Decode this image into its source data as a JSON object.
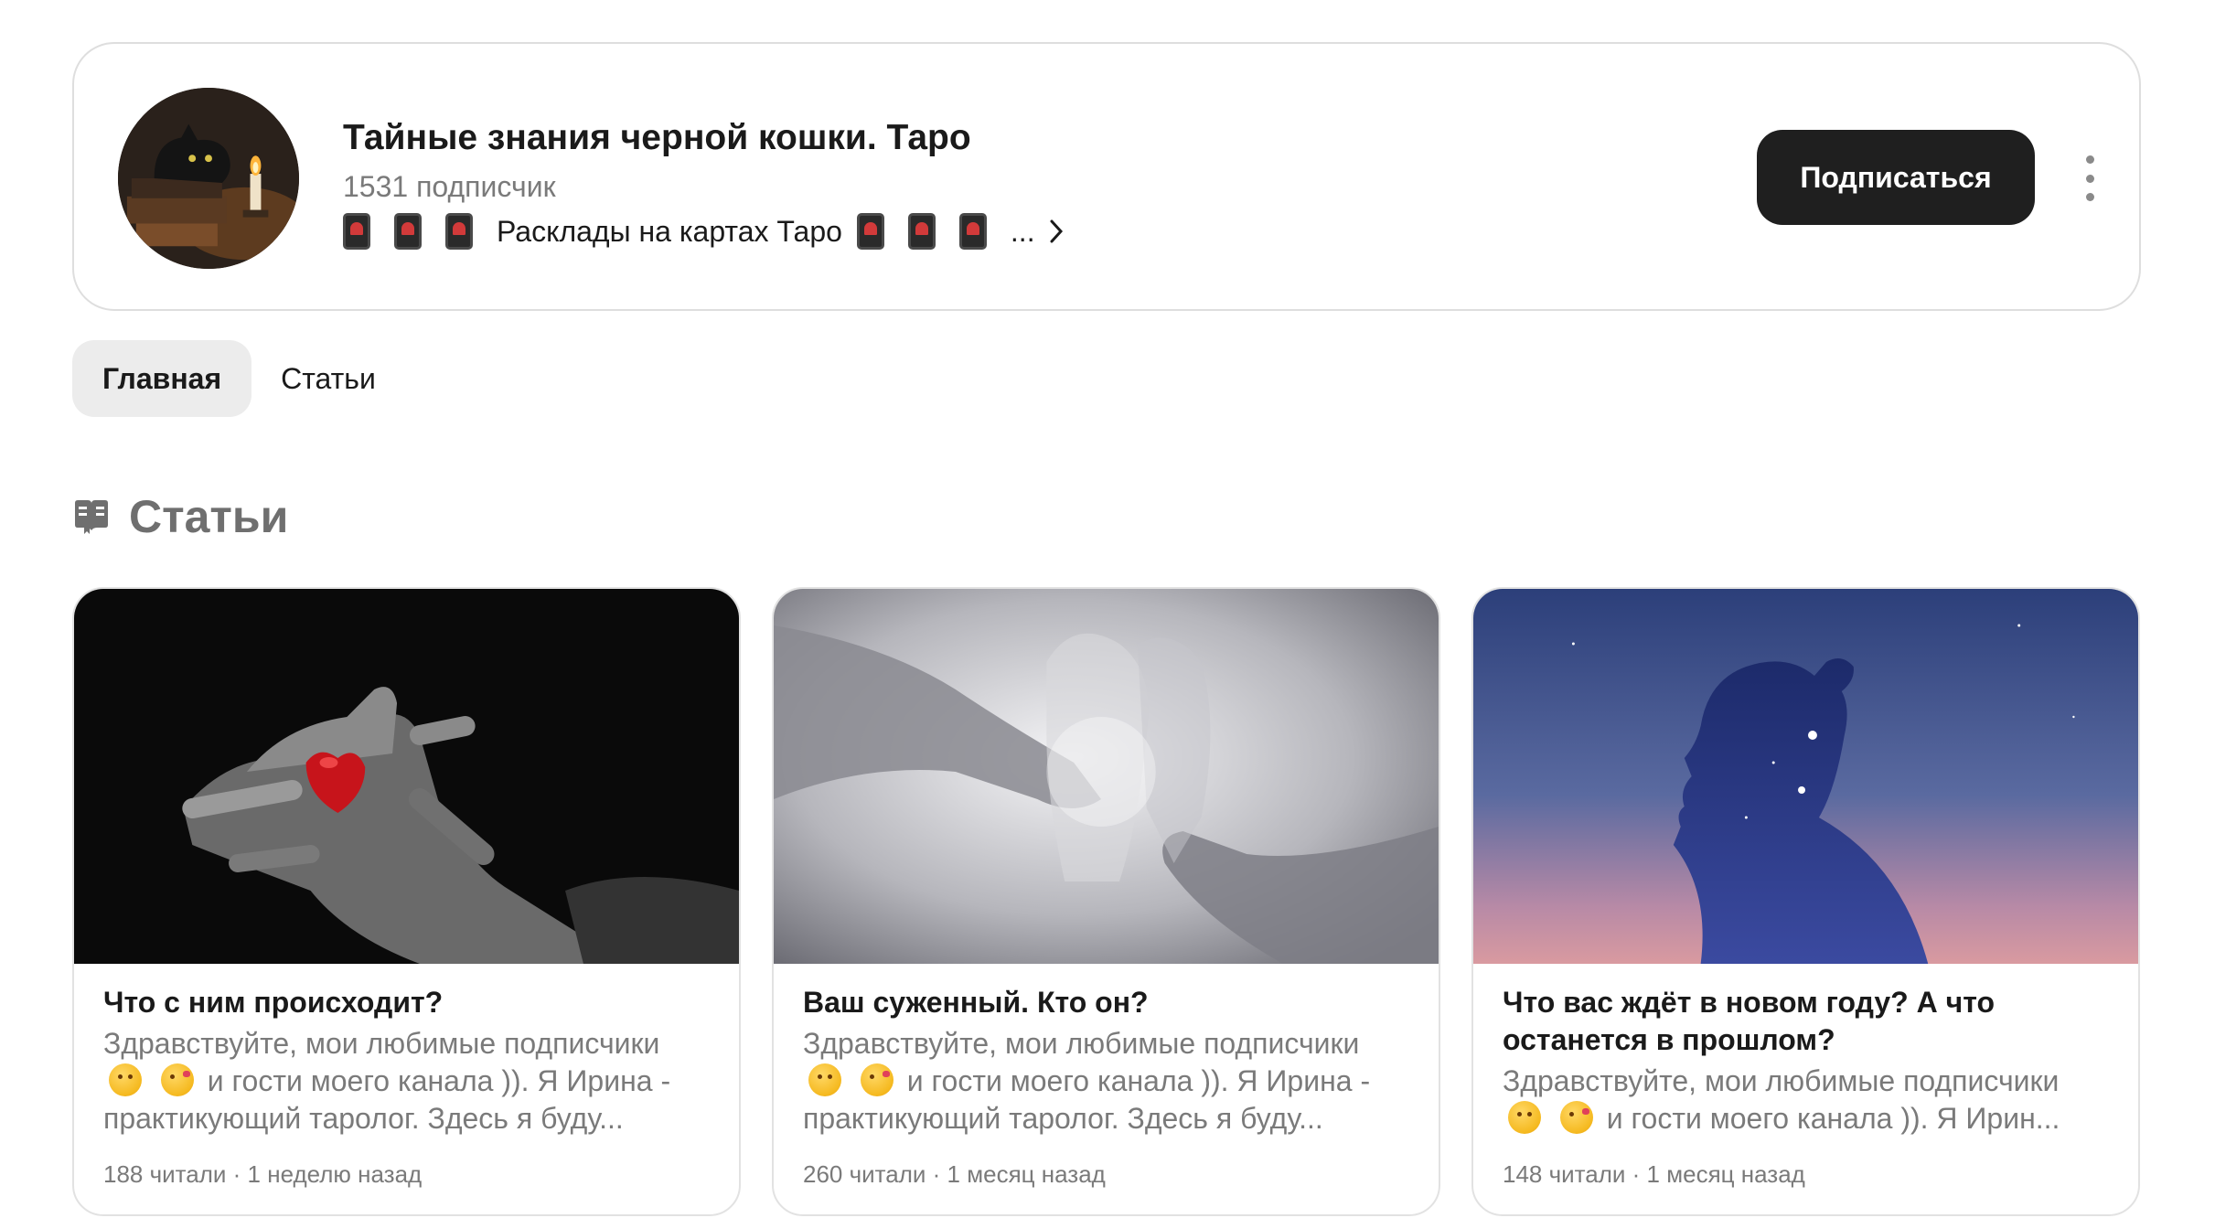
{
  "channel": {
    "title": "Тайные знания черной кошки. Таро",
    "subscribers": "1531 подписчик",
    "description_text": "Расклады на картах Таро",
    "ellipsis": "...",
    "subscribe_label": "Подписаться",
    "avatar_icon": "black-cat-candle-icon",
    "more_icon": "vertical-dots-icon"
  },
  "tabs": [
    {
      "label": "Главная",
      "active": true
    },
    {
      "label": "Статьи",
      "active": false
    }
  ],
  "section": {
    "title": "Статьи",
    "icon": "book-open-icon"
  },
  "articles": [
    {
      "title": "Что с ним происходит?",
      "snippet_line1": "Здравствуйте, мои любимые подписчики",
      "snippet_line2": "и гости моего канала )). Я Ирина -",
      "snippet_line3": "практикующий таролог. Здесь я буду...",
      "meta": "188 читали · 1 неделю назад",
      "image_icon": "hand-holding-heart-image"
    },
    {
      "title": "Ваш суженный. Кто он?",
      "snippet_line1": "Здравствуйте, мои любимые подписчики",
      "snippet_line2": "и гости моего канала )). Я Ирина -",
      "snippet_line3": "практикующий таролог. Здесь я буду...",
      "meta": "260 читали · 1 месяц назад",
      "image_icon": "reaching-hands-image"
    },
    {
      "title": "Что вас ждёт в новом году? А что останется в прошлом?",
      "snippet_line1": "Здравствуйте, мои любимые подписчики",
      "snippet_line2": "и гости моего канала )). Я Ирин...",
      "meta": "148 читали · 1 месяц назад",
      "image_icon": "woman-silhouette-stars-image"
    }
  ],
  "colors": {
    "button_bg": "#1f1f1f",
    "active_tab_bg": "#ececec",
    "muted_text": "#7a7a7a",
    "card_border": "#e2e2e2"
  }
}
